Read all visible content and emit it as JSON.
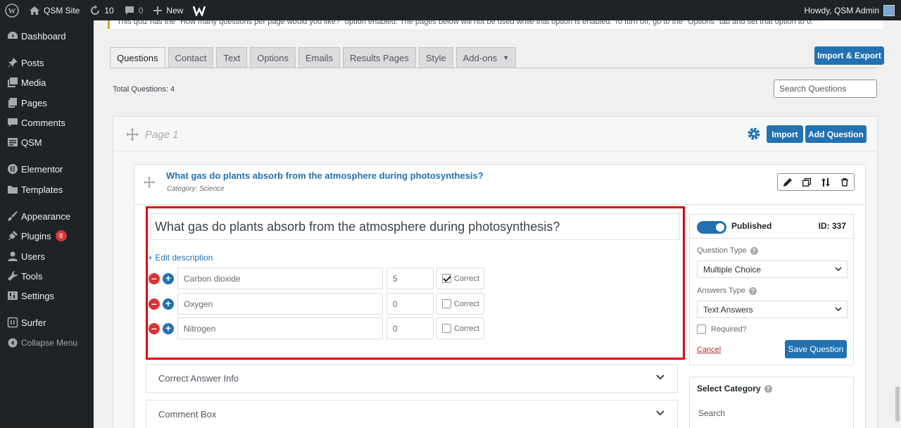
{
  "adminbar": {
    "site_name": "QSM Site",
    "updates_count": "10",
    "comments_count": "0",
    "new_label": "New",
    "greeting": "Howdy, QSM Admin"
  },
  "menu": {
    "items": [
      {
        "label": "Dashboard",
        "icon": "dashboard-icon"
      },
      {
        "label": "Posts",
        "icon": "pin-icon"
      },
      {
        "label": "Media",
        "icon": "media-icon"
      },
      {
        "label": "Pages",
        "icon": "pages-icon"
      },
      {
        "label": "Comments",
        "icon": "comments-icon"
      },
      {
        "label": "QSM",
        "icon": "qsm-icon"
      },
      {
        "label": "Elementor",
        "icon": "elementor-icon"
      },
      {
        "label": "Templates",
        "icon": "folder-icon"
      },
      {
        "label": "Appearance",
        "icon": "brush-icon"
      },
      {
        "label": "Plugins",
        "icon": "plugin-icon",
        "badge": "8"
      },
      {
        "label": "Users",
        "icon": "users-icon"
      },
      {
        "label": "Tools",
        "icon": "wrench-icon"
      },
      {
        "label": "Settings",
        "icon": "settings-icon"
      },
      {
        "label": "Surfer",
        "icon": "surfer-icon"
      },
      {
        "label": "Collapse Menu",
        "icon": "collapse-icon"
      }
    ]
  },
  "notice": "This quiz has the \"How many questions per page would you like?\" option enabled. The pages below will not be used while that option is enabled. To turn off, go to the \"Options\" tab and set that option to 0.",
  "tabs": [
    "Questions",
    "Contact",
    "Text",
    "Options",
    "Emails",
    "Results Pages",
    "Style",
    "Add-ons"
  ],
  "import_export_label": "Import & Export",
  "total_questions_label": "Total Questions: 4",
  "search_questions_placeholder": "Search Questions",
  "page": {
    "title": "Page 1",
    "import_label": "Import",
    "add_question_label": "Add Question"
  },
  "question": {
    "title": "What gas do plants absorb from the atmosphere during photosynthesis?",
    "category": "Category: Science",
    "text": "What gas do plants absorb from the atmosphere during photosynthesis?",
    "edit_description": "+ Edit description",
    "correct_label": "Correct",
    "answers": [
      {
        "text": "Carbon dioxide",
        "points": "5",
        "correct": true
      },
      {
        "text": "Oxygen",
        "points": "0",
        "correct": false
      },
      {
        "text": "Nitrogen",
        "points": "0",
        "correct": false
      }
    ],
    "sections": [
      "Correct Answer Info",
      "Comment Box"
    ]
  },
  "sidebar": {
    "status": "Published",
    "id_label": "ID: 337",
    "question_type_label": "Question Type",
    "question_type_value": "Multiple Choice",
    "answers_type_label": "Answers Type",
    "answers_type_value": "Text Answers",
    "required_label": "Required?",
    "cancel_label": "Cancel",
    "save_label": "Save Question",
    "select_category_label": "Select Category",
    "category_search_placeholder": "Search"
  }
}
